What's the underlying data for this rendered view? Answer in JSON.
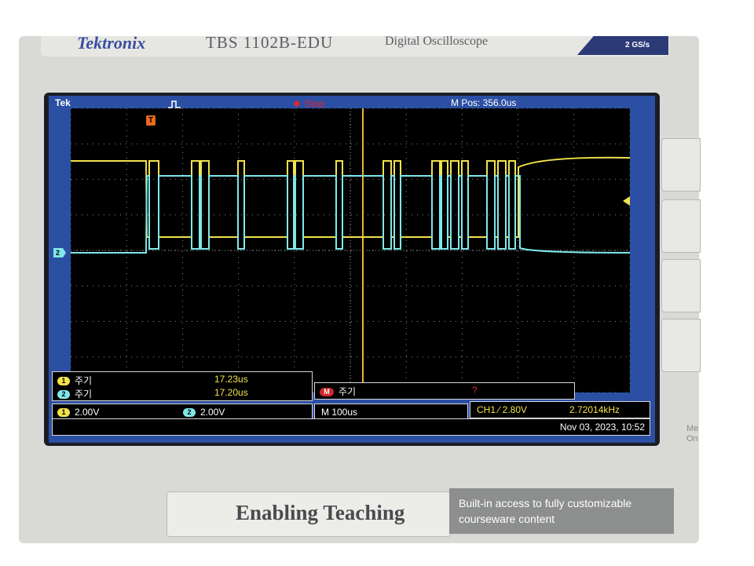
{
  "device": {
    "brand": "Tektronix",
    "model": "TBS 1102B-EDU",
    "type": "Digital Oscilloscope",
    "sample_rate": "2 GS/s",
    "edge_text": "Me\nOn"
  },
  "screen": {
    "logo": "Tek",
    "run_state": "Stop",
    "trigger_marker": "T",
    "m_pos": "M Pos: 356.0us",
    "ch2_marker": "2"
  },
  "measurements": {
    "ch1_period_label": "주기",
    "ch1_period_value": "17.23us",
    "ch2_period_label": "주기",
    "ch2_period_value": "17.20us",
    "math_period_label": "주기",
    "math_period_value": "?"
  },
  "badges": {
    "ch1": "1",
    "ch2": "2",
    "math": "M"
  },
  "status": {
    "ch1_scale": "2.00V",
    "ch2_scale": "2.00V",
    "timebase": "M 100us",
    "trigger": "CH1 ⁄ 2.80V",
    "frequency": "2.72014kHz",
    "datetime": "Nov 03, 2023, 10:52"
  },
  "footer": {
    "slogan": "Enabling Teaching",
    "tagline": "Built-in access to fully customizable courseware content"
  },
  "colors": {
    "ch1": "#f2e34b",
    "ch2": "#7fe8ea",
    "screen_bg": "#2b4fa3",
    "trigger_orange": "#e86a1f",
    "stop_red": "#e5232c"
  },
  "icons": [
    "pulse-icon",
    "stop-dot-icon",
    "trigger-position-icon",
    "trigger-level-arrow-icon"
  ]
}
